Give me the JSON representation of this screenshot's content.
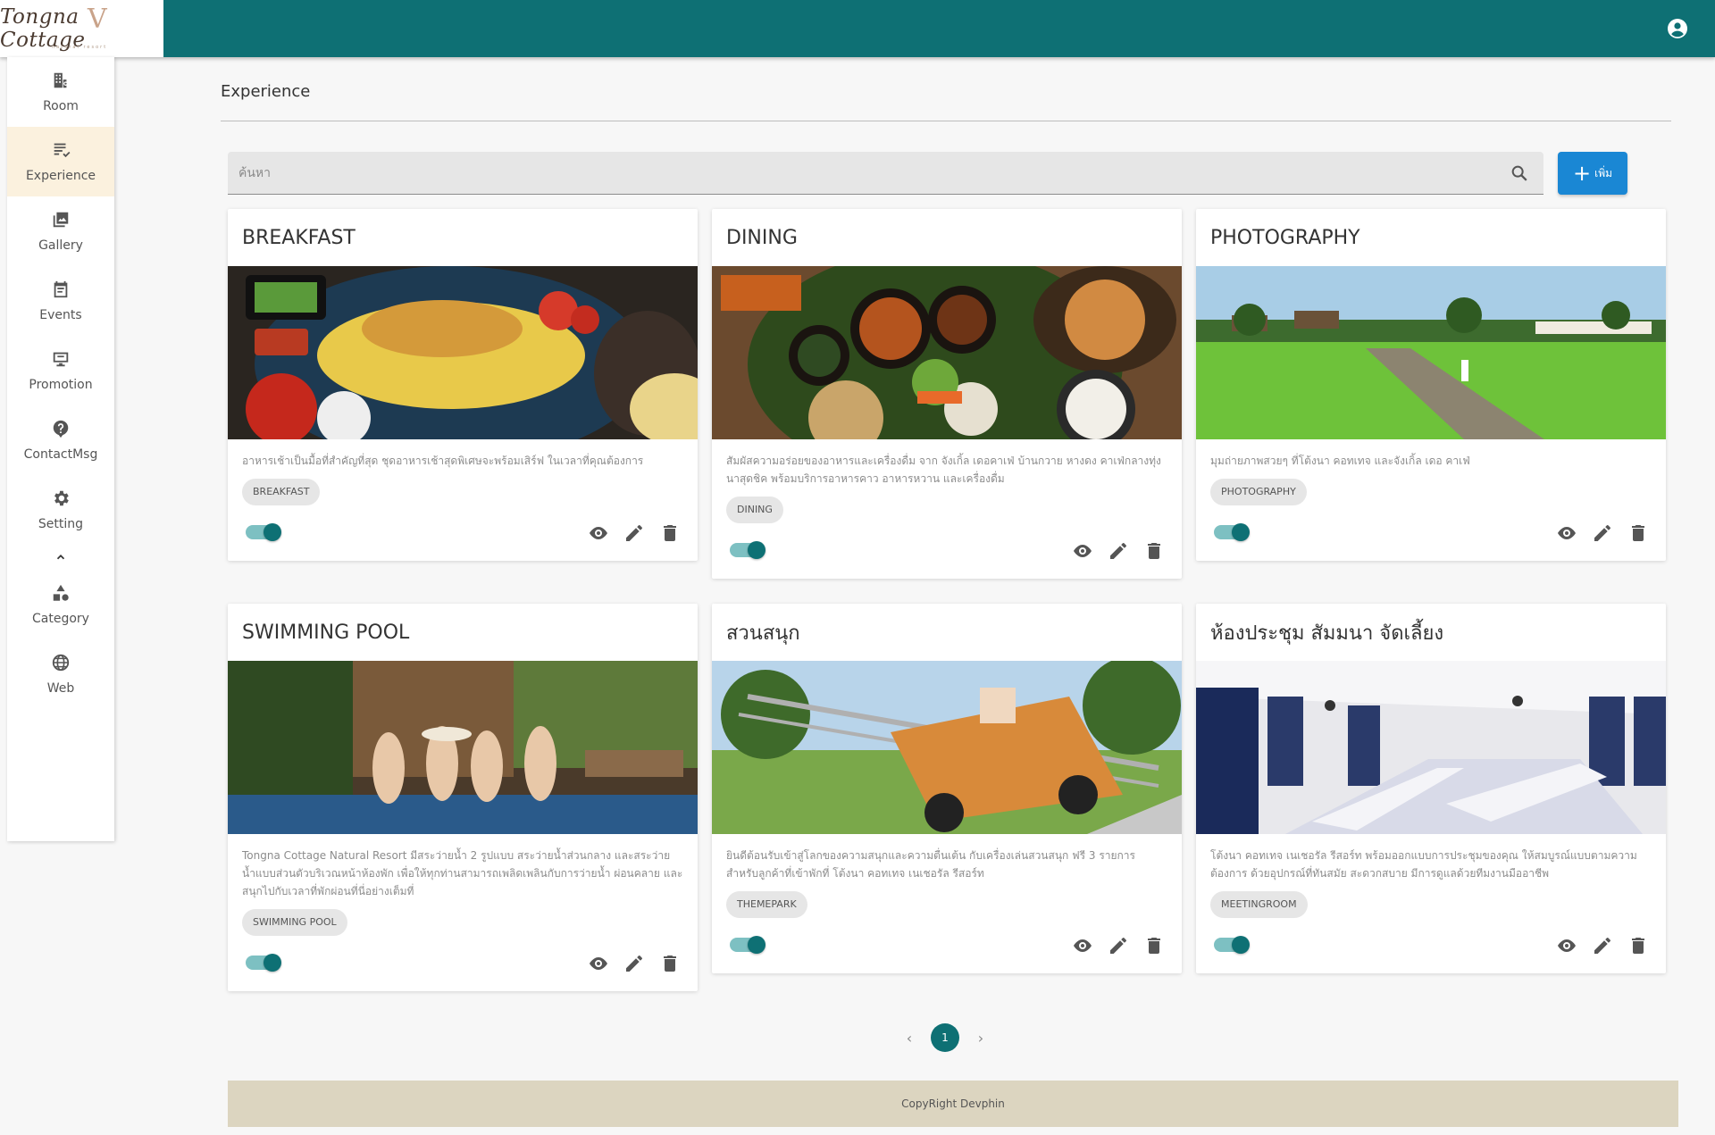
{
  "brand": {
    "logo_text": "Tongna Cottage",
    "logo_subtext": "natural resort"
  },
  "colors": {
    "primary": "#0e7074",
    "accent_blue": "#1a87d4",
    "active_nav_bg": "#fbf1de",
    "footer_bg": "#dcd5c0"
  },
  "sidebar": {
    "items": [
      {
        "label": "Room",
        "icon": "room-icon",
        "active": false
      },
      {
        "label": "Experience",
        "icon": "experience-icon",
        "active": true
      },
      {
        "label": "Gallery",
        "icon": "gallery-icon",
        "active": false
      },
      {
        "label": "Events",
        "icon": "events-icon",
        "active": false
      },
      {
        "label": "Promotion",
        "icon": "promotion-icon",
        "active": false
      },
      {
        "label": "ContactMsg",
        "icon": "help-icon",
        "active": false
      },
      {
        "label": "Setting",
        "icon": "gear-icon",
        "active": false
      },
      {
        "label": "Category",
        "icon": "category-icon",
        "active": false
      },
      {
        "label": "Web",
        "icon": "globe-icon",
        "active": false
      }
    ]
  },
  "page": {
    "title": "Experience"
  },
  "search": {
    "placeholder": "ค้นหา",
    "value": ""
  },
  "toolbar": {
    "add_label": "เพิ่ม"
  },
  "cards": [
    {
      "title": "BREAKFAST",
      "description": "อาหารเช้าเป็นมื้อที่สำคัญที่สุด ชุดอาหารเช้าสุดพิเศษจะพร้อมเสิร์ฟ ในเวลาที่คุณต้องการ",
      "tag": "BREAKFAST",
      "enabled": true
    },
    {
      "title": "DINING",
      "description": "สัมผัสความอร่อยของอาหารและเครื่องดื่ม จาก จังเกิ้ล เดอคาเฟ่ บ้านกวาย หางดง คาเฟ่กลางทุ่งนาสุดชิค พร้อมบริการอาหารคาว อาหารหวาน และเครื่องดื่ม",
      "tag": "DINING",
      "enabled": true
    },
    {
      "title": "PHOTOGRAPHY",
      "description": "มุมถ่ายภาพสวยๆ ที่โต้งนา คอทเทจ และจังเกิ้ล เดอ คาเฟ่",
      "tag": "PHOTOGRAPHY",
      "enabled": true
    },
    {
      "title": "SWIMMING POOL",
      "description": "Tongna Cottage Natural Resort มีสระว่ายน้ำ 2 รูปแบบ สระว่ายน้ำส่วนกลาง และสระว่ายน้ำแบบส่วนตัวบริเวณหน้าห้องพัก เพื่อให้ทุกท่านสามารถเพลิดเพลินกับการว่ายน้ำ ผ่อนคลาย และสนุกไปกับเวลาที่พักผ่อนที่นี่อย่างเต็มที่",
      "tag": "SWIMMING POOL",
      "enabled": true
    },
    {
      "title": "สวนสนุก",
      "description": "ยินดีต้อนรับเข้าสู่โลกของความสนุกและความตื่นเต้น กับเครื่องเล่นสวนสนุก ฟรี 3 รายการ สำหรับลูกค้าที่เข้าพักที่ โต้งนา คอทเทจ เนเชอรัล รีสอร์ท",
      "tag": "THEMEPARK",
      "enabled": true
    },
    {
      "title": "ห้องประชุม สัมมนา จัดเลี้ยง",
      "description": "โต้งนา คอทเทจ เนเชอรัล รีสอร์ท พร้อมออกแบบการประชุมของคุณ ให้สมบูรณ์แบบตามความต้องการ ด้วยอุปกรณ์ที่ทันสมัย สะดวกสบาย มีการดูแลด้วยทีมงานมืออาชีพ",
      "tag": "MEETINGROOM",
      "enabled": true
    }
  ],
  "pagination": {
    "current": "1",
    "prev": "‹",
    "next": "›"
  },
  "footer": {
    "text": "CopyRight Devphin"
  }
}
